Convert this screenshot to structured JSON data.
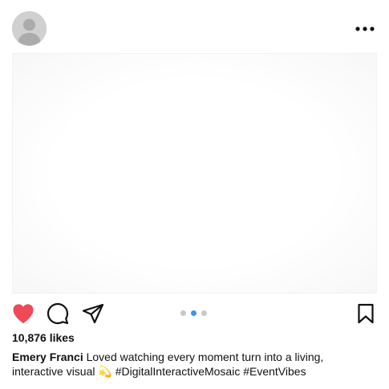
{
  "header": {
    "avatar_icon": "person-placeholder-icon",
    "more_icon": "more-horizontal-icon"
  },
  "media": {
    "carousel_total": 3,
    "carousel_active": 2
  },
  "actions": {
    "like_icon": "heart-filled-icon",
    "like_color": "#ed4956",
    "comment_icon": "comment-bubble-icon",
    "share_icon": "paper-plane-icon",
    "save_icon": "bookmark-icon",
    "dot_active_color": "#3897f0",
    "dot_inactive_color": "#c8c8c8"
  },
  "post": {
    "likes": "10,876 likes",
    "username": "Emery Franci",
    "caption": "Loved watching every moment turn into a living, interactive visual 💫 #DigitalInteractiveMosaic #EventVibes"
  }
}
